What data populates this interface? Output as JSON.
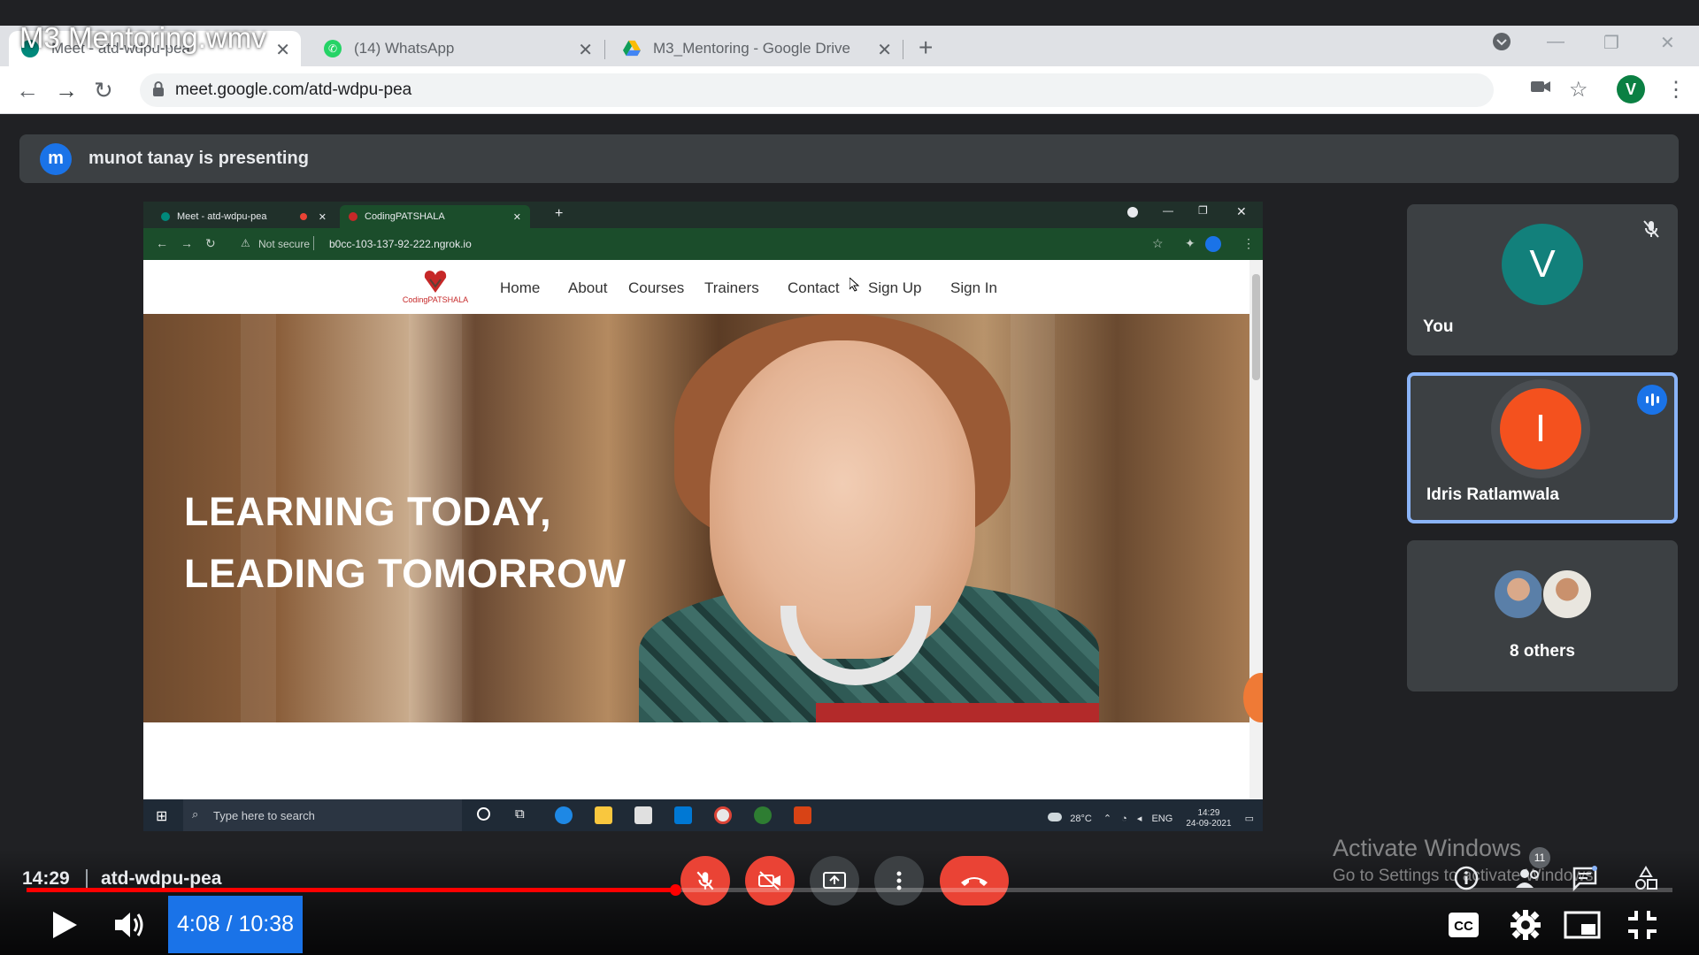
{
  "video": {
    "title": "M3 Mentoring.wmv"
  },
  "browser": {
    "tabs": [
      {
        "label": "Meet - atd-wdpu-pea"
      },
      {
        "label": "(14) WhatsApp"
      },
      {
        "label": "M3_Mentoring - Google Drive"
      }
    ],
    "url": "meet.google.com/atd-wdpu-pea",
    "profile_initial": "V"
  },
  "meet": {
    "presenting_initial": "m",
    "presenting_text": "munot tanay is presenting",
    "time": "14:29",
    "code": "atd-wdpu-pea",
    "participants": [
      {
        "initial": "V",
        "name": "You",
        "color": "#12807b"
      },
      {
        "initial": "I",
        "name": "Idris Ratlamwala",
        "color": "#f4511e"
      },
      {
        "name": "8 others"
      }
    ],
    "participant_count": "11"
  },
  "shared_screen": {
    "tabs": [
      {
        "label": "Meet - atd-wdpu-pea"
      },
      {
        "label": "CodingPATSHALA"
      }
    ],
    "security": "Not secure",
    "url": "b0cc-103-137-92-222.ngrok.io",
    "site": {
      "logo_text": "CodingPATSHALA",
      "nav": [
        "Home",
        "About",
        "Courses",
        "Trainers",
        "Contact",
        "Sign Up",
        "Sign In"
      ],
      "hero_line1": "LEARNING TODAY,",
      "hero_line2": "LEADING TOMORROW"
    },
    "taskbar": {
      "search_placeholder": "Type here to search",
      "temperature": "28°C",
      "lang": "ENG",
      "time": "14:29",
      "date": "24-09-2021"
    }
  },
  "watermark": {
    "line1": "Activate Windows",
    "line2": "Go to Settings to activate Windows."
  },
  "player": {
    "progress_fraction": 0.394,
    "time_display": "4:08 / 10:38"
  }
}
